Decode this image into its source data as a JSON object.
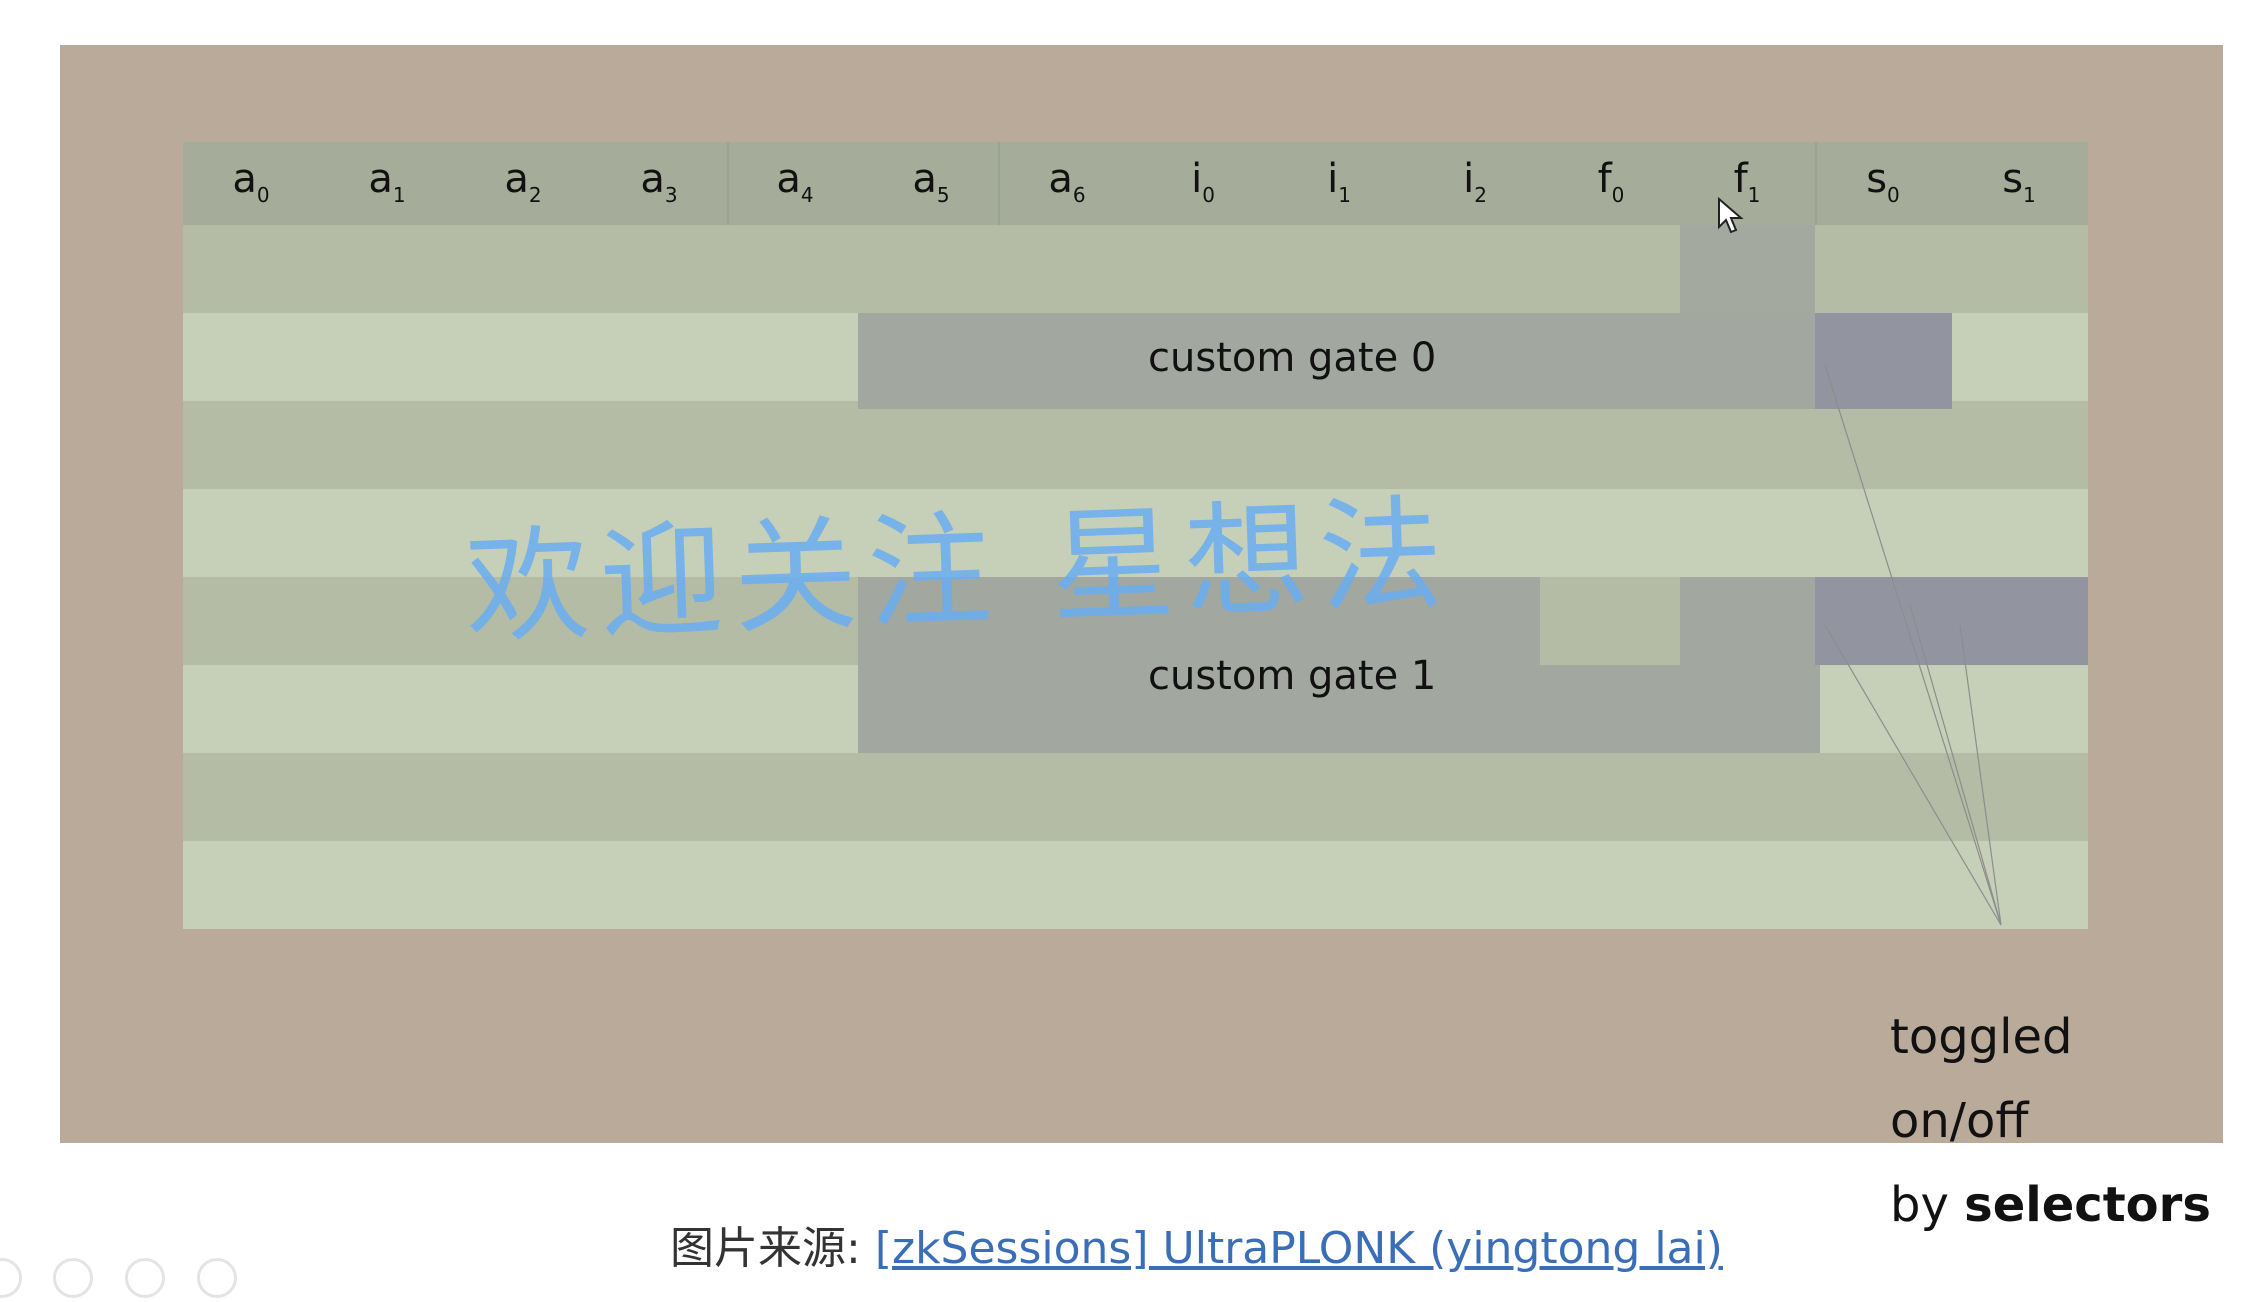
{
  "columns": [
    {
      "base": "a",
      "sub": "0"
    },
    {
      "base": "a",
      "sub": "1"
    },
    {
      "base": "a",
      "sub": "2"
    },
    {
      "base": "a",
      "sub": "3"
    },
    {
      "base": "a",
      "sub": "4"
    },
    {
      "base": "a",
      "sub": "5"
    },
    {
      "base": "a",
      "sub": "6"
    },
    {
      "base": "i",
      "sub": "0"
    },
    {
      "base": "i",
      "sub": "1"
    },
    {
      "base": "i",
      "sub": "2"
    },
    {
      "base": "f",
      "sub": "0"
    },
    {
      "base": "f",
      "sub": "1"
    },
    {
      "base": "s",
      "sub": "0"
    },
    {
      "base": "s",
      "sub": "1"
    }
  ],
  "gates": [
    {
      "label": "custom gate 0"
    },
    {
      "label": "custom gate 1"
    }
  ],
  "note": {
    "line1": "toggled on/off",
    "line2_prefix": "by ",
    "line2_bold": "selectors"
  },
  "watermark": "欢迎关注 星想法",
  "caption": {
    "prefix": "图片来源: ",
    "link_text": "[zkSessions] UltraPLONK (yingtong lai)"
  },
  "colors": {
    "slide_bg": "#b9aa9a",
    "row_dark": "#b4bca6",
    "row_light": "#c6cfb8",
    "gate": "#a2a79f",
    "selector_on": "#92959f",
    "watermark": "#6aaef2",
    "link": "#3a6fb8"
  }
}
